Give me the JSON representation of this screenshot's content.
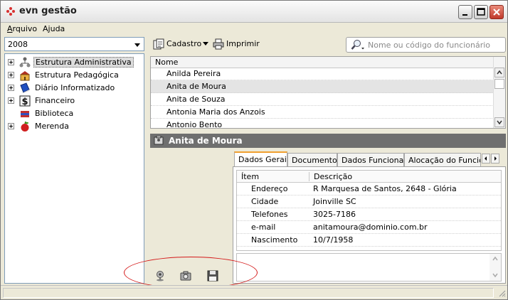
{
  "window": {
    "title": "evn gestão"
  },
  "menu": [
    {
      "label": "Arquivo",
      "accel": "A",
      "rest": "rquivo"
    },
    {
      "label": "Ajuda",
      "accel": "j",
      "pre": "A",
      "rest": "uda"
    }
  ],
  "year_select": {
    "value": "2008"
  },
  "tree": [
    {
      "label": "Estrutura Administrativa",
      "icon": "org-chart-icon",
      "selected": true,
      "expandable": true
    },
    {
      "label": "Estrutura Pedagógica",
      "icon": "school-building-icon",
      "expandable": true
    },
    {
      "label": "Diário Informatizado",
      "icon": "book-icon",
      "expandable": true
    },
    {
      "label": "Financeiro",
      "icon": "dollar-icon",
      "expandable": true
    },
    {
      "label": "Biblioteca",
      "icon": "books-icon",
      "expandable": false
    },
    {
      "label": "Merenda",
      "icon": "apple-icon",
      "expandable": true
    }
  ],
  "toolbar": {
    "cadastro_label": "Cadastro",
    "imprimir_label": "Imprimir"
  },
  "search": {
    "placeholder": "Nome ou código do funcionário"
  },
  "list": {
    "header": "Nome",
    "rows": [
      "Anilda Pereira",
      "Anita de Moura",
      "Anita de Souza",
      "Antonia Maria dos Anzois",
      "Antonio Bento"
    ],
    "selected_index": 1
  },
  "detail": {
    "title": "Anita de Moura"
  },
  "tabs": [
    "Dados Gerais",
    "Documentos",
    "Dados Funcionais",
    "Alocação do Funcion"
  ],
  "grid": {
    "headers": {
      "item": "Ítem",
      "desc": "Descrição"
    },
    "rows": [
      {
        "item": "Endereço",
        "desc": "R Marquesa de Santos, 2648 - Glória"
      },
      {
        "item": "Cidade",
        "desc": "Joinville SC"
      },
      {
        "item": "Telefones",
        "desc": "3025-7186"
      },
      {
        "item": "e-mail",
        "desc": "anitamoura@dominio.com.br"
      },
      {
        "item": "Nascimento",
        "desc": "10/7/1958"
      }
    ]
  },
  "colors": {
    "annotation": "#d41818",
    "detail_bar": "#6f6f6f",
    "active_tab_accent": "#f0a030"
  }
}
